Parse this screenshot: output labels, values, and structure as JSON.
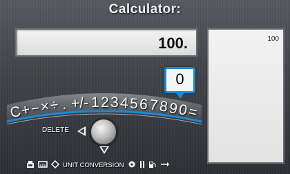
{
  "title": "Calculator:",
  "display": {
    "value": "100."
  },
  "history": {
    "entries": [
      "100"
    ]
  },
  "keyboard": {
    "characters": [
      "C",
      "+",
      "−",
      "×",
      "÷",
      ".",
      "+/-",
      "1",
      "2",
      "3",
      "4",
      "5",
      "6",
      "7",
      "8",
      "9",
      "0",
      "="
    ],
    "selected_key": "0"
  },
  "controls": {
    "delete_label": "DELETE"
  },
  "bottom_bar": {
    "unit_conversion_label": "UNIT CONVERSION",
    "icons": [
      "time-icon",
      "unit-icon",
      "diamond-icon",
      "gear-icon",
      "fuel-pump-icon",
      "fuel-icon",
      "arrow-icon"
    ]
  },
  "colors": {
    "accent": "#1a8ad8",
    "panel": "#e4e4e4",
    "background": "#3f4246"
  }
}
